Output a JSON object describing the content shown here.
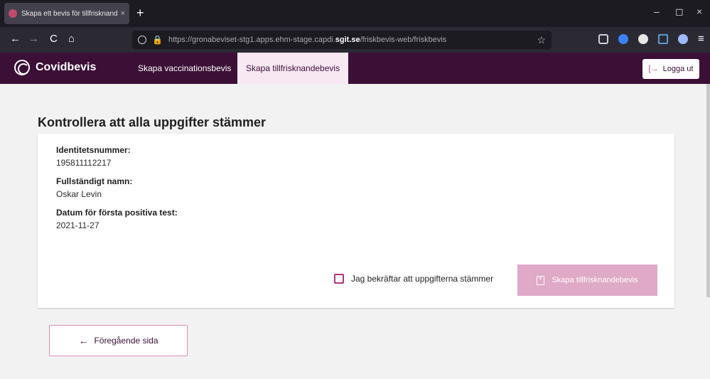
{
  "browser": {
    "tab_title": "Skapa ett bevis för tillfrisknande",
    "tab_close": "×",
    "new_tab": "+",
    "url_prefix": "https://gronabeviset-stg1.apps.ehm-stage.capdi.",
    "url_domain": "sgit.se",
    "url_path": "/friskbevis-web/friskbevis",
    "back": "←",
    "forward": "→",
    "reload": "C",
    "home": "⌂",
    "star": "☆",
    "menu": "≡",
    "minimize": "–",
    "restore": "◻",
    "close": "×"
  },
  "app": {
    "brand": "Covidbevis",
    "nav": [
      {
        "label": "Skapa vaccinationsbevis",
        "active": false
      },
      {
        "label": "Skapa tillfrisknandebevis",
        "active": true
      }
    ],
    "logout_label": "Logga ut",
    "logout_icon": "[→"
  },
  "main": {
    "title": "Kontrollera att alla uppgifter stämmer",
    "fields": [
      {
        "label": "Identitetsnummer:",
        "value": "195811112217"
      },
      {
        "label": "Fullständigt namn:",
        "value": "Oskar Levin"
      },
      {
        "label": "Datum för första positiva test:",
        "value": "2021-11-27"
      }
    ],
    "confirm_label": "Jag bekräftar att uppgifterna stämmer",
    "confirm_checked": false,
    "create_button": "Skapa tillfrisknandebevis",
    "back_button": "Föregående sida",
    "back_arrow": "←"
  },
  "colors": {
    "header": "#3c0f37",
    "accent": "#b0347a",
    "button_disabled": "#dfa9c7",
    "active_tab": "#f7e8f2"
  }
}
